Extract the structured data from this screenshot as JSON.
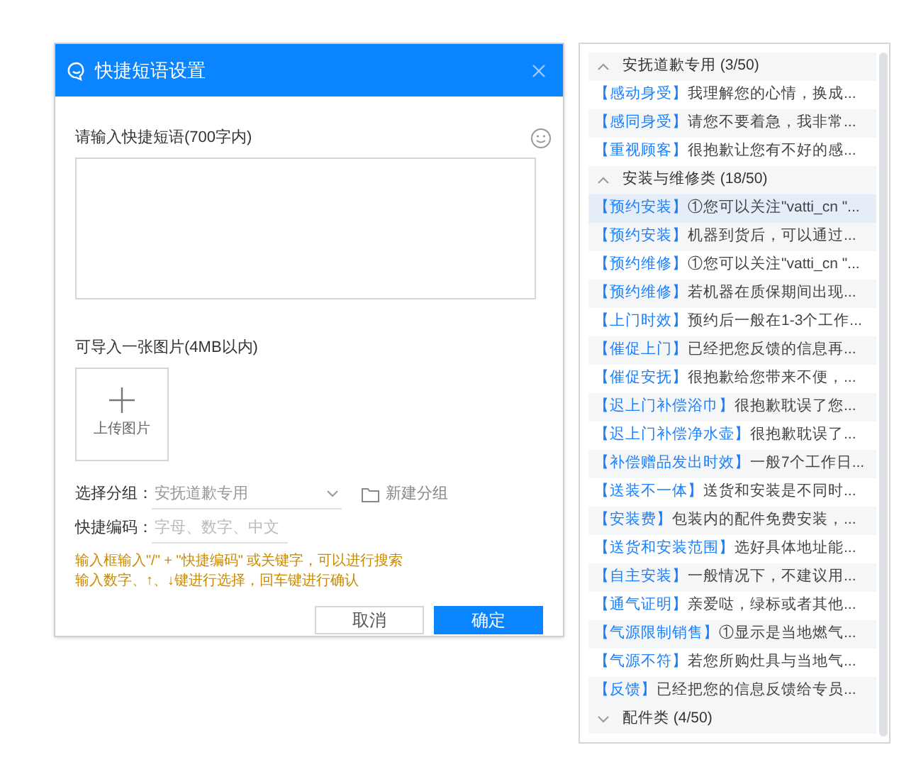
{
  "dialog": {
    "title": "快捷短语设置",
    "content_label": "请输入快捷短语(700字内)",
    "image_label": "可导入一张图片(4MB以内)",
    "upload_label": "上传图片",
    "group_label": "选择分组：",
    "group_value": "安抚道歉专用",
    "new_group": "新建分组",
    "code_label": "快捷编码：",
    "code_placeholder": "字母、数字、中文",
    "hints": [
      "输入框输入\"/\" + \"快捷编码\" 或关键字，可以进行搜索",
      "输入数字、↑、↓键进行选择，回车键进行确认"
    ],
    "buttons": [
      {
        "label": "取消",
        "kind": "secondary"
      },
      {
        "label": "确定",
        "kind": "primary"
      }
    ]
  },
  "phrase_groups": [
    {
      "title": "安抚道歉专用 (3/50)",
      "expanded": true,
      "items": [
        {
          "tag": "【感动身受】",
          "text": "我理解您的心情，换成...",
          "selected": false
        },
        {
          "tag": "【感同身受】",
          "text": "请您不要着急，我非常...",
          "selected": false
        },
        {
          "tag": "【重视顾客】",
          "text": "很抱歉让您有不好的感...",
          "selected": false
        }
      ]
    },
    {
      "title": "安装与维修类 (18/50)",
      "expanded": true,
      "items": [
        {
          "tag": "【预约安装】",
          "text": "①您可以关注\"vatti_cn \"...",
          "selected": true
        },
        {
          "tag": "【预约安装】",
          "text": "机器到货后，可以通过...",
          "selected": false
        },
        {
          "tag": "【预约维修】",
          "text": "①您可以关注\"vatti_cn \"...",
          "selected": false
        },
        {
          "tag": "【预约维修】",
          "text": "若机器在质保期间出现...",
          "selected": false
        },
        {
          "tag": "【上门时效】",
          "text": "预约后一般在1-3个工作...",
          "selected": false
        },
        {
          "tag": "【催促上门】",
          "text": "已经把您反馈的信息再...",
          "selected": false
        },
        {
          "tag": "【催促安抚】",
          "text": "很抱歉给您带来不便，...",
          "selected": false
        },
        {
          "tag": "【迟上门补偿浴巾】",
          "text": "很抱歉耽误了您...",
          "selected": false
        },
        {
          "tag": "【迟上门补偿净水壶】",
          "text": "很抱歉耽误了...",
          "selected": false
        },
        {
          "tag": "【补偿赠品发出时效】",
          "text": "一般7个工作日...",
          "selected": false
        },
        {
          "tag": "【送装不一体】",
          "text": "送货和安装是不同时...",
          "selected": false
        },
        {
          "tag": "【安装费】",
          "text": "包装内的配件免费安装，...",
          "selected": false
        },
        {
          "tag": "【送货和安装范围】",
          "text": "选好具体地址能...",
          "selected": false
        },
        {
          "tag": "【自主安装】",
          "text": "一般情况下，不建议用...",
          "selected": false
        },
        {
          "tag": "【通气证明】",
          "text": "亲爱哒，绿标或者其他...",
          "selected": false
        },
        {
          "tag": "【气源限制销售】",
          "text": "①显示是当地燃气...",
          "selected": false
        },
        {
          "tag": "【气源不符】",
          "text": "若您所购灶具与当地气...",
          "selected": false
        },
        {
          "tag": "【反馈】",
          "text": "已经把您的信息反馈给专员...",
          "selected": false
        }
      ]
    },
    {
      "title": "配件类 (4/50)",
      "expanded": false
    }
  ]
}
